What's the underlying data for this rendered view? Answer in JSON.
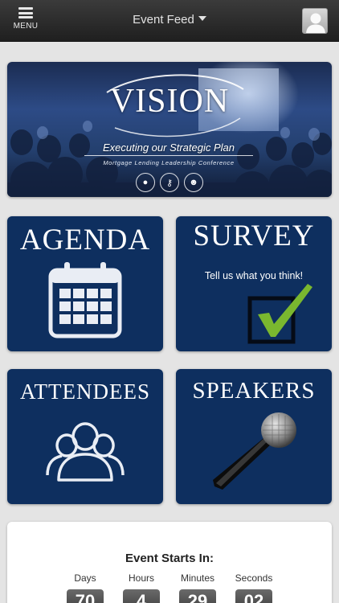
{
  "topbar": {
    "menu_label": "MENU",
    "title": "Event Feed"
  },
  "banner": {
    "logo_text": "VISION",
    "tagline": "Executing our Strategic Plan",
    "subtitle": "Mortgage Lending Leadership Conference"
  },
  "tiles": {
    "agenda": "AGENDA",
    "survey": "SURVEY",
    "survey_tagline": "Tell us what you think!",
    "attendees": "ATTENDEES",
    "speakers": "SPEAKERS"
  },
  "countdown": {
    "title": "Event Starts In:",
    "units": [
      {
        "label": "Days",
        "value": "70"
      },
      {
        "label": "Hours",
        "value": "4"
      },
      {
        "label": "Minutes",
        "value": "29"
      },
      {
        "label": "Seconds",
        "value": "02"
      }
    ]
  },
  "colors": {
    "tile_bg": "#0e2f5f",
    "check_green": "#7ab72f",
    "page_bg": "#e4e4e4"
  }
}
